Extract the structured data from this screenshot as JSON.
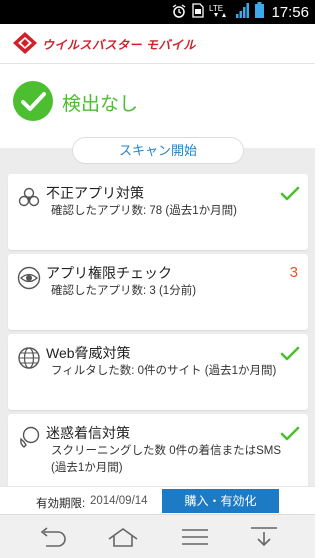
{
  "status_bar": {
    "time": "17:56",
    "network": "LTE",
    "icons": [
      "alarm-icon",
      "sim-icon",
      "lte-icon",
      "signal-icon",
      "battery-icon"
    ]
  },
  "app": {
    "logo_text": "ウイルスバスター モバイル",
    "brand_color": "#d0202a"
  },
  "status": {
    "text": "検出なし",
    "color": "#4cbf31"
  },
  "scan_button": {
    "label": "スキャン開始"
  },
  "cards": [
    {
      "icon": "biohazard-icon",
      "title": "不正アプリ対策",
      "description": "確認したアプリ数: 78 (過去1か月間)",
      "state": "check"
    },
    {
      "icon": "eye-icon",
      "title": "アプリ権限チェック",
      "description": "確認したアプリ数: 3 (1分前)",
      "count": "3"
    },
    {
      "icon": "globe-icon",
      "title": "Web脅威対策",
      "description": "フィルタした数: 0件のサイト (過去1か月間)",
      "state": "check"
    },
    {
      "icon": "phone-chat-icon",
      "title": "迷惑着信対策",
      "description": "スクリーニングした数 0件の着信またはSMS (過去1か月間)",
      "state": "check"
    }
  ],
  "footer": {
    "expiry_label": "有効期限:",
    "expiry_date": "2014/09/14",
    "buy_label": "購入・有効化"
  },
  "nav": [
    "back-icon",
    "home-icon",
    "menu-icon",
    "download-icon"
  ]
}
